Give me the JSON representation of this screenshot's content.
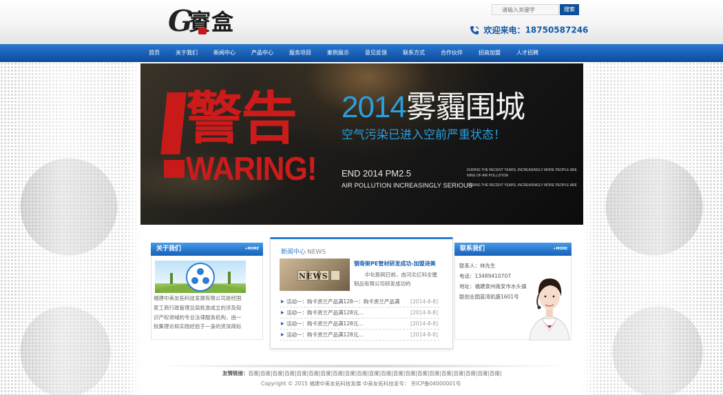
{
  "header": {
    "logo_letter": "G",
    "logo_text": "賨盒",
    "search_placeholder": "请输入关键字",
    "search_button": "搜索",
    "hotline_label": "欢迎来电：",
    "hotline_number": "18750587246"
  },
  "nav": {
    "items": [
      {
        "label": "首页"
      },
      {
        "label": "关于我们"
      },
      {
        "label": "新闻中心"
      },
      {
        "label": "产品中心"
      },
      {
        "label": "服务项目"
      },
      {
        "label": "案例展示"
      },
      {
        "label": "意见反馈"
      },
      {
        "label": "联系方式"
      },
      {
        "label": "合作伙伴"
      },
      {
        "label": "招商加盟"
      },
      {
        "label": "人才招聘"
      }
    ]
  },
  "banner": {
    "warning_cn": "警告",
    "warning_en": "WARING!",
    "title_year": "2014",
    "title_cn": "雾霾围城",
    "subtitle": "空气污染已进入空前严重状态！",
    "end_line": "END 2014  PM2.5",
    "air_line": "AIR POLLUTION INCREASINGLY SERIOUS",
    "small_1": "DURING THE RECENT YEARS, INCREASINGLY MORE PEOPLE ARE",
    "small_2": "NING OF AIR POLLUTION",
    "small_3": "DURING THE RECENT YEARS, INCREASINGLY MORE PEOPLE ARE"
  },
  "about": {
    "title": "关于我们",
    "more": "+MORE",
    "text": "福建中美友拓科技发展有限公司是经国家工商行政管理总局批准成立的涉及知识产权领域的专业法律服务机构，由一批集理论和实践经验于一身的资深商标代理人、专利代理人和律师"
  },
  "news": {
    "title_cn": "新闻中心",
    "title_en": "NEWS",
    "image_word": "NEWS",
    "headline": "钢骨架PE管材研发成功-加盟诗美",
    "summary": "中化新网日前，由河北亿科全厘制品有限公司研发成功的",
    "items": [
      {
        "title": "活动一：购卡资兰产品满128一：购卡资兰产品满",
        "date": "[2014-8-8]"
      },
      {
        "title": "活动一：购卡资兰产品满128元...",
        "date": "[2014-8-8]"
      },
      {
        "title": "活动一：购卡资兰产品满128元...",
        "date": "[2014-8-8]"
      },
      {
        "title": "活动一：购卡资兰产品满128元...",
        "date": "[2014-8-8]"
      }
    ]
  },
  "contact": {
    "title": "联系我们",
    "more": "+MORE",
    "person": "联系人：林先生",
    "phone": "电话：13489410707",
    "address_1": "地址：福建泉州南安市水头镇",
    "address_2": "联创业园蓝湾机盛1601号"
  },
  "footer": {
    "links_label": "友情链接：",
    "links": "百度|百度|百度|百度|百度|百度|百度|百度|百度|百度|百度|百度|百度|百度|百度|百度|百度|百度|百度|百度|百度|",
    "copyright": "Copyright © 2015 福建中美友拓科技发展 中美友拓科技发号： 京ICP备04000001号"
  },
  "colors": {
    "brand_blue": "#1b62b8",
    "warning_red": "#cc1b1b",
    "banner_blue": "#2aa0e0"
  }
}
